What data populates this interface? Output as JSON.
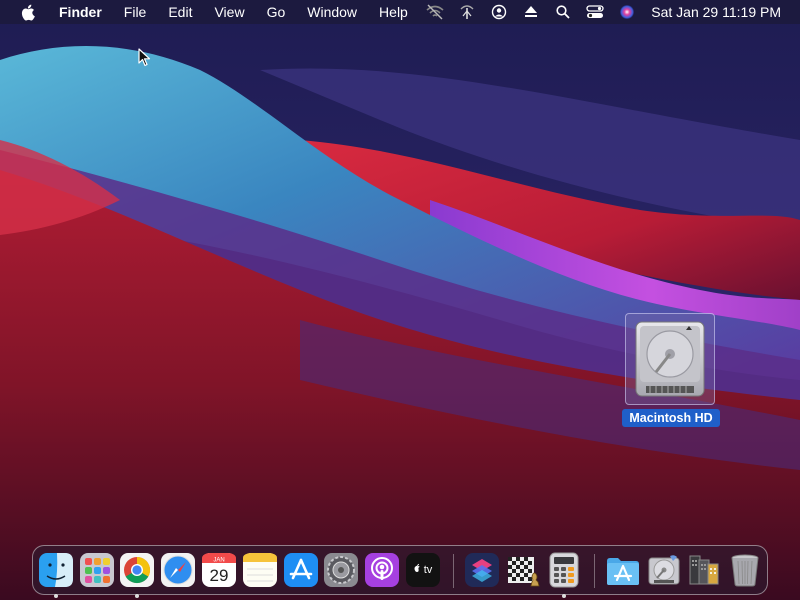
{
  "menubar": {
    "app_name": "Finder",
    "menus": [
      "File",
      "Edit",
      "View",
      "Go",
      "Window",
      "Help"
    ],
    "status_icons": [
      "wifi-off-icon",
      "antenna-icon",
      "user-icon",
      "eject-icon",
      "search-icon",
      "control-center-icon",
      "siri-icon"
    ],
    "clock": "Sat Jan 29  11:19 PM"
  },
  "desktop": {
    "icons": [
      {
        "label": "Macintosh HD",
        "icon": "hard-drive-icon",
        "selected": true
      }
    ]
  },
  "dock": {
    "apps": [
      {
        "name": "finder",
        "running": true
      },
      {
        "name": "launchpad",
        "running": false
      },
      {
        "name": "chrome",
        "running": true
      },
      {
        "name": "safari",
        "running": false
      },
      {
        "name": "calendar",
        "running": false,
        "month": "JAN",
        "day": "29"
      },
      {
        "name": "notes",
        "running": false
      },
      {
        "name": "app-store",
        "running": false
      },
      {
        "name": "system-preferences",
        "running": false
      },
      {
        "name": "podcasts",
        "running": false
      },
      {
        "name": "apple-tv",
        "running": false,
        "label": "tv"
      },
      {
        "name": "shortcuts",
        "running": false
      },
      {
        "name": "chess",
        "running": false
      },
      {
        "name": "calculator",
        "running": true
      },
      {
        "name": "applications-folder",
        "running": false
      },
      {
        "name": "disk-utility",
        "running": false
      },
      {
        "name": "recent-documents",
        "running": false
      },
      {
        "name": "trash",
        "running": false
      }
    ]
  },
  "colors": {
    "selection": "#1f5fc9",
    "wallpaper_base": "#1c1a4a",
    "wallpaper_red": "#c8203a",
    "wallpaper_teal": "#3a8fc0",
    "wallpaper_magenta": "#c040d8"
  }
}
